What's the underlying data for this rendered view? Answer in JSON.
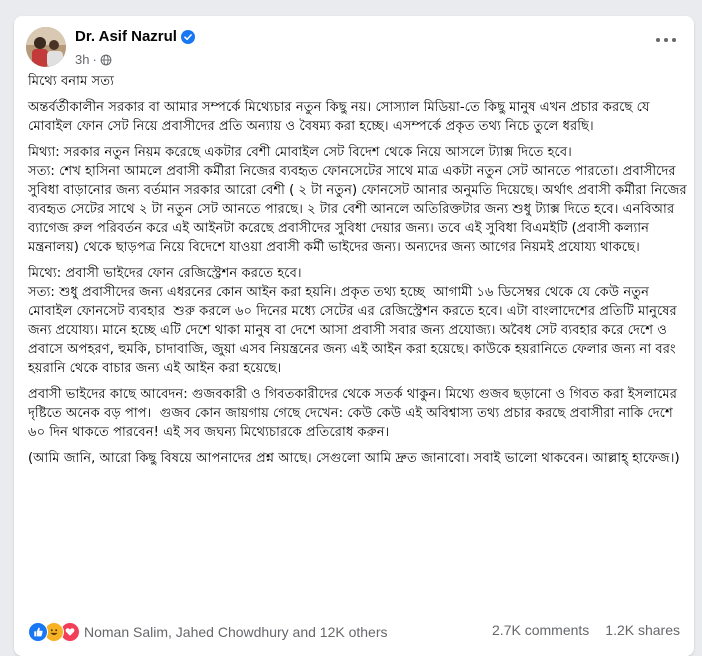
{
  "post": {
    "author": "Dr. Asif Nazrul",
    "time": "3h",
    "paragraphs": [
      "মিথ্যে বনাম সত্য",
      "অন্তর্বর্তীকালীন সরকার বা আমার সম্পর্কে মিথ্যেচার নতুন কিছু নয়। সোস্যাল মিডিয়া-তে কিছু মানুষ এখন প্রচার করছে যে মোবাইল ফোন সেট নিয়ে প্রবাসীদের প্রতি অন্যায় ও বৈষম্য করা হচ্ছে। এসম্পর্কে প্রকৃত তথ্য নিচে তুলে ধরছি।",
      "মিথ্যা: সরকার নতুন নিয়ম করেছে একটার বেশী মোবাইল সেট বিদেশ থেকে নিয়ে আসলে ট্যাক্স দিতে হবে।\nসত্য: শেখ হাসিনা আমলে প্রবাসী কর্মীরা নিজের ব্যবহৃত ফোনসেটের সাথে মাত্র একটা নতুন সেট আনতে পারতো। প্রবাসীদের সুবিধা বাড়ানোর জন্য বর্তমান সরকার আরো বেশী ( ২ টা নতুন) ফোনসেট আনার অনুমতি দিয়েছে। অর্থাৎ প্রবাসী কর্মীরা নিজের ব্যবহৃত সেটের সাথে ২ টা নতুন সেট আনতে পারছে। ২ টার বেশী আনলে অতিরিক্তটার জন্য শুধু ট্যাক্স দিতে হবে। এনবিআর ব্যাগেজ রুল পরিবর্তন করে এই আইনটা করেছে প্রবাসীদের সুবিধা দেয়ার জন্য। তবে এই সুবিধা বিএমইটি (প্রবাসী কল্যান মন্ত্রনালয়) থেকে ছাড়পত্র নিয়ে বিদেশে যাওয়া প্রবাসী কর্মী ভাইদের জন্য। অন্যদের জন্য আগের নিয়মই প্রযোয্য থাকছে।",
      "মিথ্যে: প্রবাসী ভাইদের ফোন রেজিস্ট্রেশন করতে হবে।\nসত্য: শুধু প্রবাসীদের জন্য এধরনের কোন আইন করা হয়নি। প্রকৃত তথ্য হচ্ছে  আগামী ১৬ ডিসেম্বর থেকে যে কেউ নতুন মোবাইল ফোনসেট ব্যবহার  শুরু করলে ৬০ দিনের মধ্যে সেটের এর রেজিস্ট্রেশন করতে হবে। এটা বাংলাদেশের প্রতিটি মানুষের জন্য প্রযোয্য। মানে হচ্ছে এটি দেশে থাকা মানুষ বা দেশে আসা প্রবাসী সবার জন্য প্রযোজ্য। অবৈধ সেট ব্যবহার করে দেশে ও প্রবাসে অপহরণ, হুমকি, চাদাবাজি, জুয়া এসব নিয়ন্ত্রনের জন্য এই আইন করা হয়েছে। কাউকে হয়রানিতে ফেলার জন্য না বরং হয়রানি থেকে বাচার জন্য এই আইন করা হয়েছে।",
      "প্রবাসী ভাইদের কাছে আবেদন: গুজবকারী ও গিবতকারীদের থেকে সতর্ক থাকুন। মিথ্যে গুজব ছড়ানো ও গিবত করা ইসলামের দৃষ্টিতে অনেক বড় পাপ।  গুজব কোন জায়গায় গেছে দেখেন: কেউ কেউ এই অবিশ্বাস্য তথ্য প্রচার করছে প্রবাসীরা নাকি দেশে ৬০ দিন থাকতে পারবেন! এই সব জঘন্য মিথ্যেচারকে প্রতিরোধ করুন।",
      "(আমি জানি, আরো কিছু বিষয়ে আপনাদের প্রশ্ন আছে। সেগুলো আমি দ্রুত জানাবো। সবাই ভালো থাকবেন। আল্লাহ্ হাফেজ।)"
    ]
  },
  "footer": {
    "reactors": "Noman Salim, Jahed Chowdhury and 12K others",
    "comments": "2.7K comments",
    "shares": "1.2K shares"
  },
  "icons": {
    "verified": "verified-badge-icon",
    "privacy": "globe-icon",
    "more": "more-options-icon",
    "reactions": [
      "like-icon",
      "haha-icon",
      "love-icon"
    ]
  },
  "colors": {
    "accent": "#1877f2",
    "secondary_text": "#65676b",
    "like": "#1877f2",
    "haha": "#f7b125",
    "love": "#f33e58"
  }
}
